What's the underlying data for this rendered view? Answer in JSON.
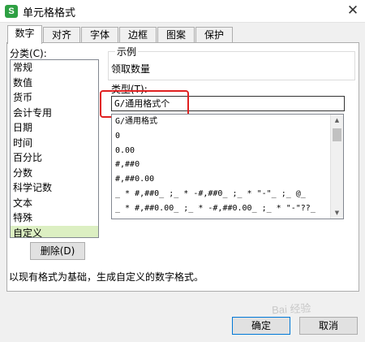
{
  "window": {
    "title": "单元格格式",
    "app_icon": "S",
    "close_glyph": "✕"
  },
  "tabs": [
    {
      "label": "数字"
    },
    {
      "label": "对齐"
    },
    {
      "label": "字体"
    },
    {
      "label": "边框"
    },
    {
      "label": "图案"
    },
    {
      "label": "保护"
    }
  ],
  "category": {
    "label": "分类(C):",
    "items": [
      "常规",
      "数值",
      "货币",
      "会计专用",
      "日期",
      "时间",
      "百分比",
      "分数",
      "科学记数",
      "文本",
      "特殊",
      "自定义"
    ],
    "selected": "自定义"
  },
  "sample": {
    "title": "示例",
    "value": "领取数量"
  },
  "type": {
    "label": "类型(T):",
    "input_value": "G/通用格式个",
    "formats": [
      "G/通用格式",
      "0",
      "0.00",
      "#,##0",
      "#,##0.00",
      "_ * #,##0_ ;_ * -#,##0_ ;_ * \"-\"_ ;_ @_",
      "_ * #,##0.00_ ;_ * -#,##0.00_ ;_ * \"-\"??_"
    ]
  },
  "buttons": {
    "delete": "删除(D)",
    "ok": "确定",
    "cancel": "取消"
  },
  "description": "以现有格式为基础，生成自定义的数字格式。",
  "watermark": "Bai 经验",
  "colors": {
    "selected_item_bg": "#dcefc2",
    "highlight_box": "#e02020",
    "ok_border": "#0078d7",
    "app_icon": "#2ea043"
  }
}
